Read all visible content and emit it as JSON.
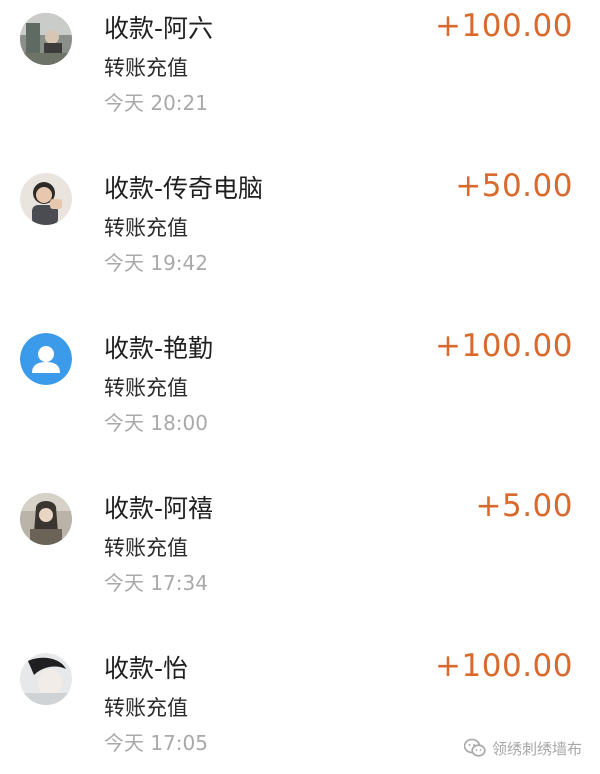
{
  "transactions": [
    {
      "title": "收款-阿六",
      "subtitle": "转账充值",
      "time": "今天  20:21",
      "amount": "+100.00",
      "avatar": "photo-avatar"
    },
    {
      "title": "收款-传奇电脑",
      "subtitle": "转账充值",
      "time": "今天  19:42",
      "amount": "+50.00",
      "avatar": "photo-avatar"
    },
    {
      "title": "收款-艳勤",
      "subtitle": "转账充值",
      "time": "今天  18:00",
      "amount": "+100.00",
      "avatar": "default-user-icon"
    },
    {
      "title": "收款-阿禧",
      "subtitle": "转账充值",
      "time": "今天  17:34",
      "amount": "+5.00",
      "avatar": "photo-avatar"
    },
    {
      "title": "收款-怡",
      "subtitle": "转账充值",
      "time": "今天  17:05",
      "amount": "+100.00",
      "avatar": "photo-avatar"
    }
  ],
  "watermark": {
    "text": "领绣刺绣墙布",
    "icon": "wechat-icon"
  },
  "colors": {
    "amount": "#d96a2e",
    "time": "#a9a9a9",
    "default_avatar": "#3b9bea"
  }
}
